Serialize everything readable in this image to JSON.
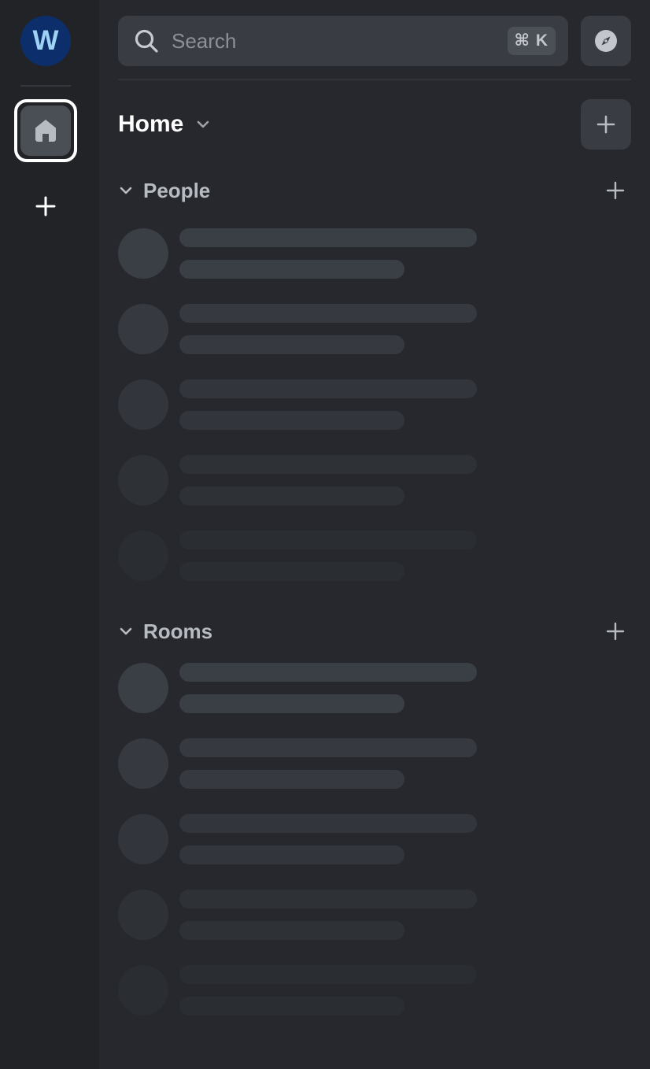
{
  "rail": {
    "avatar_initial": "W",
    "avatar_bg": "#0c2e6a",
    "home_space_icon": "home-icon",
    "add_space_icon": "plus-icon"
  },
  "search": {
    "placeholder": "Search",
    "shortcut": "⌘ K",
    "icon": "search-icon"
  },
  "explore_icon": "compass-icon",
  "home": {
    "title": "Home",
    "menu_icon": "chevron-down-icon",
    "add_icon": "plus-icon"
  },
  "sections": [
    {
      "title": "People",
      "collapse_icon": "chevron-down-icon",
      "add_icon": "plus-icon",
      "placeholder_rows": 5
    },
    {
      "title": "Rooms",
      "collapse_icon": "chevron-down-icon",
      "add_icon": "plus-icon",
      "placeholder_rows": 5
    }
  ]
}
